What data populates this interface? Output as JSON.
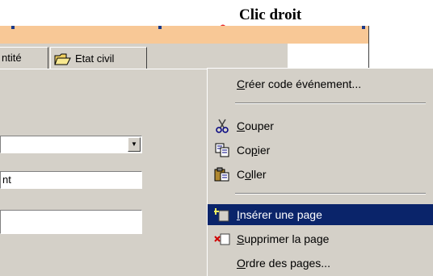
{
  "annotation": {
    "text": "Clic droit"
  },
  "tabs": [
    {
      "label": "ntité"
    },
    {
      "label": "Etat civil"
    }
  ],
  "fields": {
    "combo_value": "",
    "text1_value": "nt",
    "text2_value": ""
  },
  "context_menu": {
    "items": [
      {
        "prefix": "",
        "hot": "C",
        "rest": "réer code événement..."
      },
      {
        "prefix": "",
        "hot": "C",
        "rest": "ouper"
      },
      {
        "prefix": "Co",
        "hot": "p",
        "rest": "ier"
      },
      {
        "prefix": "C",
        "hot": "o",
        "rest": "ller"
      },
      {
        "prefix": "",
        "hot": "I",
        "rest": "nsérer une page"
      },
      {
        "prefix": "",
        "hot": "S",
        "rest": "upprimer la page"
      },
      {
        "prefix": "",
        "hot": "O",
        "rest": "rdre des pages..."
      }
    ],
    "selected_index": 4
  },
  "colors": {
    "window_strip": "#f8c896",
    "dialog_face": "#d4d0c8",
    "selection": "#0a246a",
    "arrow": "#e8282c"
  },
  "icons": [
    "folder-icon",
    "scissors-icon",
    "copy-icon",
    "paste-icon",
    "insert-page-icon",
    "delete-page-icon",
    "dropdown-arrow-icon"
  ]
}
